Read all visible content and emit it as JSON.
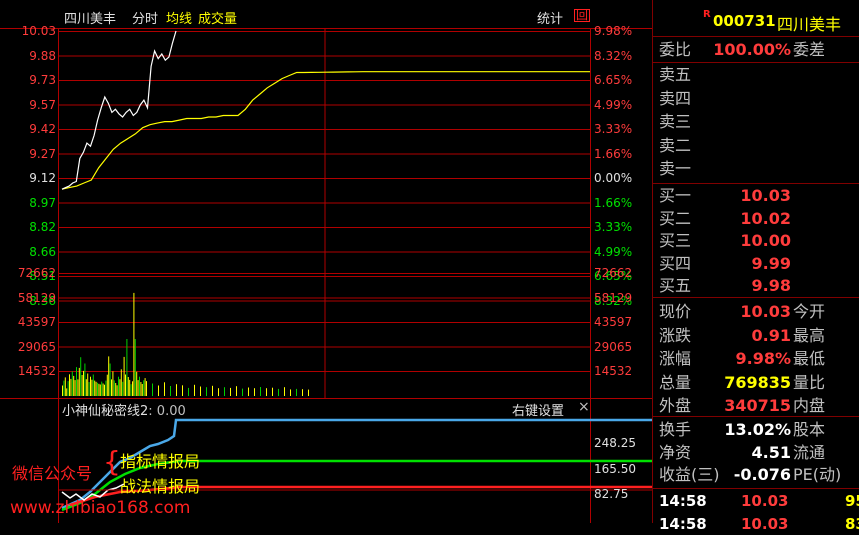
{
  "header": {
    "stock_name": "四川美丰",
    "tab_intraday": "分时",
    "tab_avg": "均线",
    "tab_volume": "成交量",
    "stats_label": "统计",
    "toggle_glyph": "回"
  },
  "price_axis": {
    "left": [
      "10.03",
      "9.88",
      "9.73",
      "9.57",
      "9.42",
      "9.27",
      "9.12",
      "8.97",
      "8.82",
      "8.66",
      "8.51",
      "8.36"
    ],
    "right": [
      "9.98%",
      "8.32%",
      "6.65%",
      "4.99%",
      "3.33%",
      "1.66%",
      "0.00%",
      "1.66%",
      "3.33%",
      "4.99%",
      "6.65%",
      "8.32%"
    ]
  },
  "volume_axis": {
    "left": [
      "72662",
      "58129",
      "43597",
      "29065",
      "14532"
    ],
    "right": [
      "72662",
      "58129",
      "43597",
      "29065",
      "14532"
    ]
  },
  "indicator": {
    "title": "小神仙秘密线2",
    "value": ": 0.00",
    "settings": "右键设置",
    "close": "×",
    "axis": [
      "248.25",
      "165.50",
      "82.75"
    ]
  },
  "watermark": {
    "wechat": "微信公众号",
    "line1": "指标情报局",
    "line2": "战法情报局",
    "url": "www.zhibiao168.com"
  },
  "panel": {
    "r_mark": "R",
    "code": "000731",
    "name": "四川美丰",
    "webi_label": "委比",
    "webi_value": "100.00%",
    "weicha_label": "委差",
    "sell": [
      "卖五",
      "卖四",
      "卖三",
      "卖二",
      "卖一"
    ],
    "buy": [
      {
        "label": "买一",
        "price": "10.03"
      },
      {
        "label": "买二",
        "price": "10.02"
      },
      {
        "label": "买三",
        "price": "10.00"
      },
      {
        "label": "买四",
        "price": "9.99"
      },
      {
        "label": "买五",
        "price": "9.98"
      }
    ],
    "quote": [
      {
        "k": "现价",
        "v": "10.03",
        "k2": "今开",
        "c": "red"
      },
      {
        "k": "涨跌",
        "v": "0.91",
        "k2": "最高",
        "c": "red"
      },
      {
        "k": "涨幅",
        "v": "9.98%",
        "k2": "最低",
        "c": "red"
      },
      {
        "k": "总量",
        "v": "769835",
        "k2": "量比",
        "c": "yel"
      },
      {
        "k": "外盘",
        "v": "340715",
        "k2": "内盘",
        "c": "red"
      }
    ],
    "fund": [
      {
        "k": "换手",
        "v": "13.02%",
        "k2": "股本",
        "c": "wht"
      },
      {
        "k": "净资",
        "v": "4.51",
        "k2": "流通",
        "c": "wht"
      },
      {
        "k": "收益(三)",
        "v": "-0.076",
        "k2": "PE(动)",
        "c": "wht"
      }
    ],
    "ticks": [
      {
        "time": "14:58",
        "price": "10.03",
        "vol": "95"
      },
      {
        "time": "14:58",
        "price": "10.03",
        "vol": "83"
      }
    ]
  },
  "chart_data": {
    "type": "line",
    "price_ylim": [
      8.21,
      10.03
    ],
    "price_series": [
      {
        "name": "分时",
        "color": "#ffffff",
        "values": [
          9.0,
          9.01,
          9.02,
          9.04,
          9.05,
          9.2,
          9.24,
          9.3,
          9.28,
          9.35,
          9.45,
          9.53,
          9.6,
          9.56,
          9.5,
          9.52,
          9.49,
          9.47,
          9.5,
          9.52,
          9.48,
          9.5,
          9.55,
          9.58,
          9.53,
          9.8,
          9.9,
          9.85,
          9.88,
          9.84,
          9.86,
          9.95,
          10.03
        ]
      },
      {
        "name": "均线",
        "color": "#ffff00",
        "values": [
          9.0,
          9.01,
          9.02,
          9.04,
          9.06,
          9.14,
          9.2,
          9.26,
          9.3,
          9.33,
          9.36,
          9.4,
          9.42,
          9.43,
          9.44,
          9.44,
          9.45,
          9.46,
          9.46,
          9.46,
          9.47,
          9.47,
          9.48,
          9.48,
          9.48,
          9.52,
          9.58,
          9.62,
          9.66,
          9.69,
          9.72,
          9.74,
          9.76
        ]
      }
    ],
    "volume_values": [
      6200,
      9100,
      11000,
      4500,
      8800,
      12800,
      10100,
      14600,
      11900,
      9400,
      17100,
      9800,
      16600,
      22900,
      12400,
      14800,
      19200,
      9900,
      13300,
      8300,
      11400,
      9600,
      12700,
      9100,
      8400,
      7800,
      7200,
      6800,
      8500,
      7400,
      6700,
      9100,
      12600,
      23400,
      19200,
      9800,
      14600,
      9200,
      7700,
      6300,
      11400,
      9900,
      15800,
      8400,
      23100,
      12700,
      33700,
      11200,
      9500,
      7000,
      8700,
      60900,
      33700,
      14300,
      9400,
      11400,
      8300,
      7100,
      9300,
      10600,
      8800,
      7400,
      6200,
      8100,
      5900,
      7000,
      6300,
      4800,
      6600,
      5600,
      5200,
      6000,
      4600,
      5200,
      4800,
      5800,
      4400,
      5000,
      4600,
      5300,
      4600,
      4900,
      4200,
      5200,
      3900,
      4200,
      4000,
      3800
    ],
    "volume_ylim": [
      0,
      72662
    ]
  }
}
